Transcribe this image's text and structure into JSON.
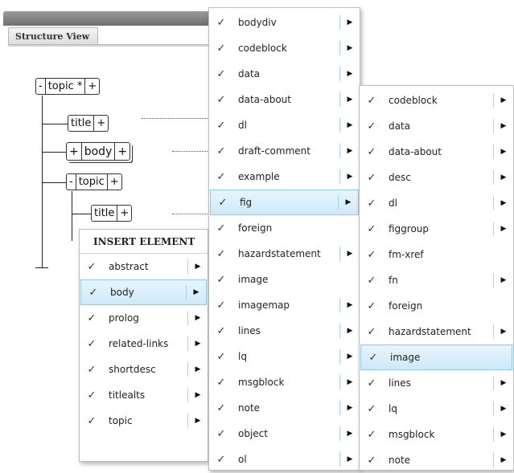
{
  "structure_view": {
    "tab_label": "Structure View",
    "tree": {
      "root": {
        "toggle": "-",
        "label": "topic *",
        "add": "+"
      },
      "title1": {
        "label": "title",
        "add": "+"
      },
      "body": {
        "expand": "+",
        "label": "body",
        "add": "+"
      },
      "topic2": {
        "toggle": "-",
        "label": "topic",
        "add": "+"
      },
      "title2": {
        "label": "title",
        "add": "+"
      }
    }
  },
  "icons": {
    "check": "check-icon",
    "submenu": "submenu-arrow-icon"
  },
  "glyphs": {
    "check": "✓",
    "arrow": "▶"
  },
  "insert_menu": {
    "header": "INSERT ELEMENT",
    "items": [
      {
        "label": "abstract",
        "submenu": true,
        "highlighted": false
      },
      {
        "label": "body",
        "submenu": true,
        "highlighted": true
      },
      {
        "label": "prolog",
        "submenu": true,
        "highlighted": false
      },
      {
        "label": "related-links",
        "submenu": true,
        "highlighted": false
      },
      {
        "label": "shortdesc",
        "submenu": true,
        "highlighted": false
      },
      {
        "label": "titlealts",
        "submenu": true,
        "highlighted": false
      },
      {
        "label": "topic",
        "submenu": true,
        "highlighted": false
      }
    ]
  },
  "body_menu": {
    "items": [
      {
        "label": "bodydiv",
        "submenu": true,
        "highlighted": false
      },
      {
        "label": "codeblock",
        "submenu": true,
        "highlighted": false
      },
      {
        "label": "data",
        "submenu": true,
        "highlighted": false
      },
      {
        "label": "data-about",
        "submenu": true,
        "highlighted": false
      },
      {
        "label": "dl",
        "submenu": true,
        "highlighted": false
      },
      {
        "label": "draft-comment",
        "submenu": true,
        "highlighted": false
      },
      {
        "label": "example",
        "submenu": true,
        "highlighted": false
      },
      {
        "label": "fig",
        "submenu": true,
        "highlighted": true
      },
      {
        "label": "foreign",
        "submenu": false,
        "highlighted": false
      },
      {
        "label": "hazardstatement",
        "submenu": true,
        "highlighted": false
      },
      {
        "label": "image",
        "submenu": false,
        "highlighted": false
      },
      {
        "label": "imagemap",
        "submenu": true,
        "highlighted": false
      },
      {
        "label": "lines",
        "submenu": true,
        "highlighted": false
      },
      {
        "label": "lq",
        "submenu": true,
        "highlighted": false
      },
      {
        "label": "msgblock",
        "submenu": true,
        "highlighted": false
      },
      {
        "label": "note",
        "submenu": true,
        "highlighted": false
      },
      {
        "label": "object",
        "submenu": true,
        "highlighted": false
      },
      {
        "label": "ol",
        "submenu": true,
        "highlighted": false
      }
    ]
  },
  "fig_menu": {
    "items": [
      {
        "label": "codeblock",
        "submenu": true,
        "highlighted": false
      },
      {
        "label": "data",
        "submenu": true,
        "highlighted": false
      },
      {
        "label": "data-about",
        "submenu": true,
        "highlighted": false
      },
      {
        "label": "desc",
        "submenu": true,
        "highlighted": false
      },
      {
        "label": "dl",
        "submenu": true,
        "highlighted": false
      },
      {
        "label": "figgroup",
        "submenu": true,
        "highlighted": false
      },
      {
        "label": "fm-xref",
        "submenu": false,
        "highlighted": false
      },
      {
        "label": "fn",
        "submenu": true,
        "highlighted": false
      },
      {
        "label": "foreign",
        "submenu": false,
        "highlighted": false
      },
      {
        "label": "hazardstatement",
        "submenu": true,
        "highlighted": false
      },
      {
        "label": "image",
        "submenu": false,
        "highlighted": true
      },
      {
        "label": "lines",
        "submenu": true,
        "highlighted": false
      },
      {
        "label": "lq",
        "submenu": true,
        "highlighted": false
      },
      {
        "label": "msgblock",
        "submenu": true,
        "highlighted": false
      },
      {
        "label": "note",
        "submenu": true,
        "highlighted": false
      }
    ]
  }
}
